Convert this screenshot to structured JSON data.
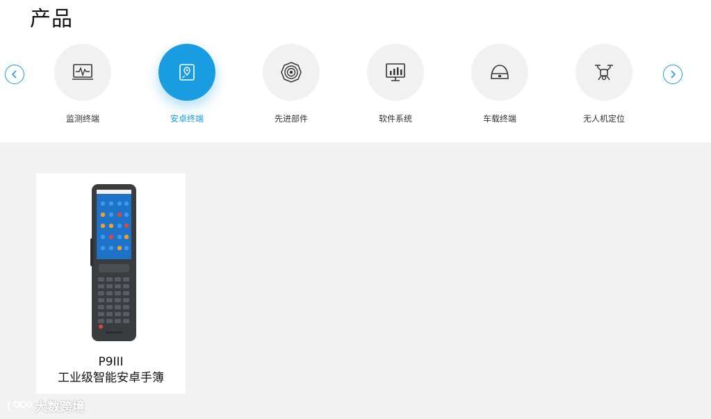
{
  "page": {
    "title": "产品"
  },
  "categories": [
    {
      "label": "监测终端",
      "icon": "monitor-waveform-icon",
      "active": false
    },
    {
      "label": "安卓终端",
      "icon": "map-location-icon",
      "active": true
    },
    {
      "label": "先进部件",
      "icon": "antenna-target-icon",
      "active": false
    },
    {
      "label": "软件系统",
      "icon": "bar-chart-screen-icon",
      "active": false
    },
    {
      "label": "车载终端",
      "icon": "vehicle-unit-icon",
      "active": false
    },
    {
      "label": "无人机定位",
      "icon": "drone-icon",
      "active": false
    }
  ],
  "product": {
    "model": "P9III",
    "desc": "工业级智能安卓手簿"
  },
  "watermark": {
    "text": "大数跨境"
  },
  "colors": {
    "accent": "#1a9de0",
    "content_bg": "#f2f2f2"
  }
}
